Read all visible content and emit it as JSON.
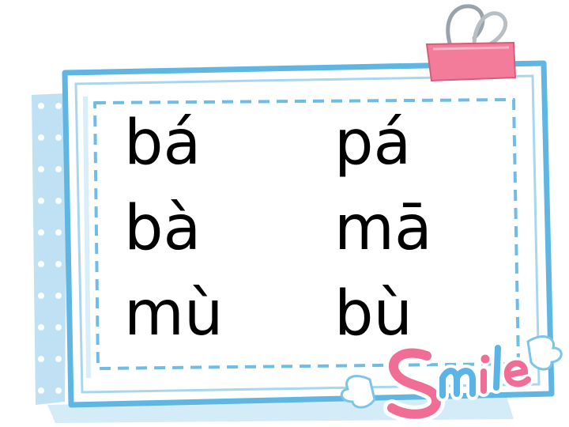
{
  "syllables": {
    "left": [
      "bá",
      "bà",
      "mù"
    ],
    "right": [
      "pá",
      "mā",
      "bù"
    ]
  },
  "decoration": {
    "logo_text": "Smile",
    "icons": [
      "binder-clip-icon",
      "smile-logo-icon",
      "wing-icon"
    ]
  },
  "colors": {
    "frame_border": "#5fb6e2",
    "frame_light": "#d8eef9",
    "clip_pink": "#f27c9a",
    "clip_metal": "#9aa3ab",
    "logo_pink": "#f06e96",
    "logo_blue": "#5ab4e6",
    "text": "#000000"
  }
}
